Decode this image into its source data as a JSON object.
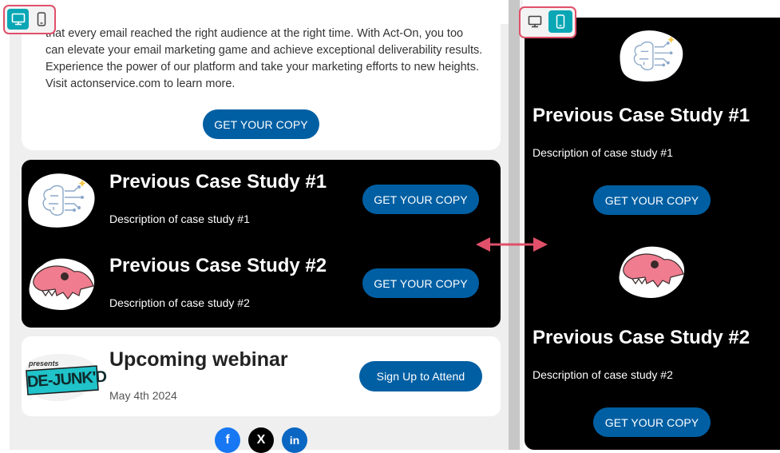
{
  "desktop_preview": {
    "intro": {
      "text": "that every email reached the right audience at the right time. With Act-On, you too can elevate your email marketing game and achieve exceptional deliverability results. Experience the power of our platform and take your marketing efforts to new heights. Visit actonservice.com to learn more.",
      "button": "GET YOUR COPY"
    },
    "case_studies": [
      {
        "title": "Previous Case Study #1",
        "description": "Description of case study #1",
        "button": "GET YOUR COPY"
      },
      {
        "title": "Previous Case Study #2",
        "description": "Description of case study #2",
        "button": "GET YOUR COPY"
      }
    ],
    "webinar": {
      "logo_text_top": "presents",
      "logo_text_main": "DE-JUNK'D",
      "title": "Upcoming webinar",
      "date": "May 4th 2024",
      "button": "Sign Up to Attend"
    },
    "social": [
      "f",
      "X",
      "in"
    ]
  },
  "mobile_preview": {
    "case_studies": [
      {
        "title": "Previous Case Study #1",
        "description": "Description of case study #1",
        "button": "GET YOUR COPY"
      },
      {
        "title": "Previous Case Study #2",
        "description": "Description of case study #2",
        "button": "GET YOUR COPY"
      }
    ]
  },
  "toggles": {
    "left": {
      "active": "desktop"
    },
    "right": {
      "active": "mobile"
    }
  },
  "colors": {
    "button_blue": "#005fa3",
    "toggle_active": "#09a7b5",
    "highlight": "#e0506a",
    "dino_pink": "#ef7d8f"
  }
}
